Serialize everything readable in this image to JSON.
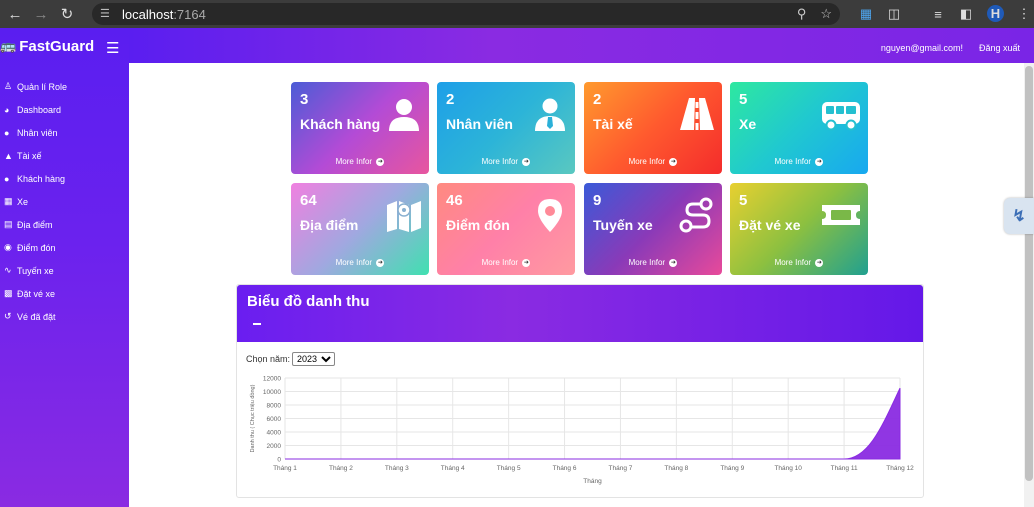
{
  "browser": {
    "url_host": "localhost",
    "url_port": ":7164",
    "profile_initial": "H"
  },
  "sidebar": {
    "brand": "FastGuard",
    "items": [
      {
        "label": "Quản lí Role",
        "icon": "users-cog-icon"
      },
      {
        "label": "Dashboard",
        "icon": "dashboard-icon"
      },
      {
        "label": "Nhân viên",
        "icon": "user-icon"
      },
      {
        "label": "Tài xế",
        "icon": "road-icon"
      },
      {
        "label": "Khách hàng",
        "icon": "user-icon"
      },
      {
        "label": "Xe",
        "icon": "bus-icon"
      },
      {
        "label": "Địa điểm",
        "icon": "map-icon"
      },
      {
        "label": "Điểm đón",
        "icon": "map-pin-icon"
      },
      {
        "label": "Tuyến xe",
        "icon": "route-icon"
      },
      {
        "label": "Đặt vé xe",
        "icon": "ticket-icon"
      },
      {
        "label": "Vé đã đặt",
        "icon": "history-icon"
      }
    ]
  },
  "topbar": {
    "email": "nguyen@gmail.com!",
    "logout": "Đăng xuất"
  },
  "cards": [
    {
      "count": "3",
      "label": "Khách hàng",
      "more": "More Infor",
      "icon": "user-icon",
      "gradient": [
        "#4b5cd6",
        "#b34bd6",
        "#e8569e"
      ]
    },
    {
      "count": "2",
      "label": "Nhân viên",
      "more": "More Infor",
      "icon": "user-tie-icon",
      "gradient": [
        "#1e9fe8",
        "#2cb4d8",
        "#5ac8c0"
      ]
    },
    {
      "count": "2",
      "label": "Tài xế",
      "more": "More Infor",
      "icon": "road-icon",
      "gradient": [
        "#ff9a2e",
        "#ff5a2e",
        "#f42c2c"
      ]
    },
    {
      "count": "5",
      "label": "Xe",
      "more": "More Infor",
      "icon": "bus-icon",
      "gradient": [
        "#2ee8a0",
        "#20c8d0",
        "#18a8f0"
      ]
    },
    {
      "count": "64",
      "label": "Địa điểm",
      "more": "More Infor",
      "icon": "map-icon",
      "gradient": [
        "#f080e0",
        "#a0a8e0",
        "#40e0b0"
      ]
    },
    {
      "count": "46",
      "label": "Điểm đón",
      "more": "More Infor",
      "icon": "map-pin-icon",
      "gradient": [
        "#ff8a80",
        "#ff80a8",
        "#ff9aa0"
      ]
    },
    {
      "count": "9",
      "label": "Tuyến xe",
      "more": "More Infor",
      "icon": "route-icon",
      "gradient": [
        "#3a5ad8",
        "#8a3ab8",
        "#e84a9a"
      ]
    },
    {
      "count": "5",
      "label": "Đặt vé xe",
      "more": "More Infor",
      "icon": "ticket-icon",
      "gradient": [
        "#e8d030",
        "#8cc040",
        "#20a090"
      ]
    }
  ],
  "panel": {
    "title": "Biểu đồ danh thu",
    "year_label": "Chọn năm:",
    "year_value": "2023"
  },
  "chart_data": {
    "type": "area",
    "categories": [
      "Tháng 1",
      "Tháng 2",
      "Tháng 3",
      "Tháng 4",
      "Tháng 5",
      "Tháng 6",
      "Tháng 7",
      "Tháng 8",
      "Tháng 9",
      "Tháng 10",
      "Tháng 11",
      "Tháng 12"
    ],
    "series": [
      {
        "values": [
          0,
          0,
          0,
          0,
          0,
          0,
          0,
          0,
          0,
          0,
          0,
          10500
        ]
      }
    ],
    "xlabel": "Tháng",
    "ylabel": "Danh thu ( Chục triệu đồng)",
    "yticks": [
      0,
      2000,
      4000,
      6000,
      8000,
      10000,
      12000
    ],
    "ylim": [
      0,
      12000
    ],
    "fill_color": "#8a2be2",
    "grid": true
  }
}
